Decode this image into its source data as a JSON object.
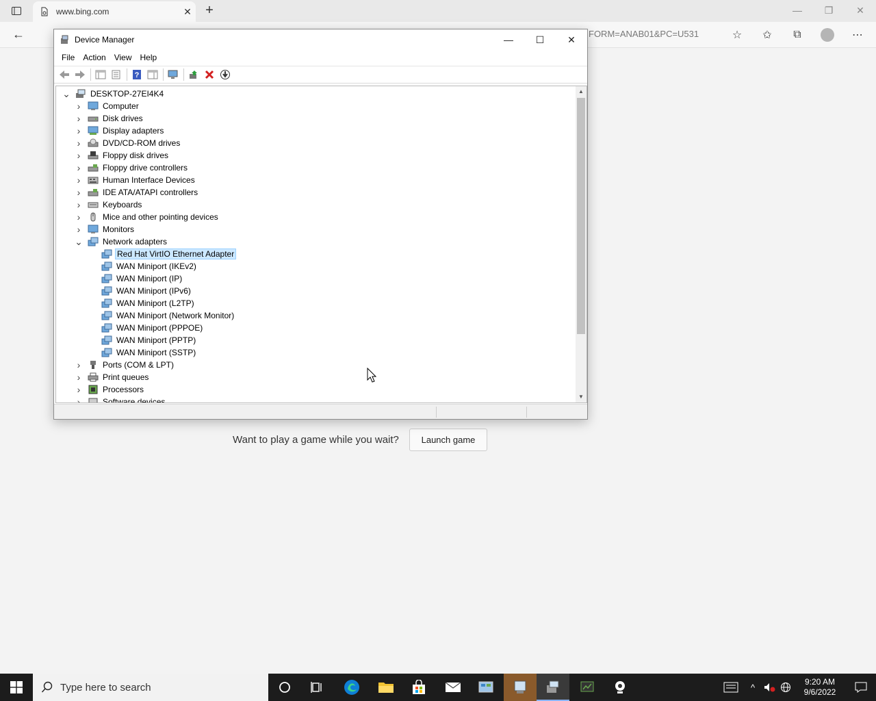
{
  "browser": {
    "tab_title": "www.bing.com",
    "url_fragment": "FORM=ANAB01&PC=U531",
    "wait_text": "Want to play a game while you wait?",
    "launch_label": "Launch game"
  },
  "device_manager": {
    "title": "Device Manager",
    "menu": [
      "File",
      "Action",
      "View",
      "Help"
    ],
    "tree": [
      {
        "label": "DESKTOP-27EI4K4",
        "level": 0,
        "state": "expanded",
        "icon": "computer-root-icon"
      },
      {
        "label": "Computer",
        "level": 1,
        "state": "collapsed",
        "icon": "monitor-icon"
      },
      {
        "label": "Disk drives",
        "level": 1,
        "state": "collapsed",
        "icon": "disk-drive-icon"
      },
      {
        "label": "Display adapters",
        "level": 1,
        "state": "collapsed",
        "icon": "display-adapter-icon"
      },
      {
        "label": "DVD/CD-ROM drives",
        "level": 1,
        "state": "collapsed",
        "icon": "dvd-icon"
      },
      {
        "label": "Floppy disk drives",
        "level": 1,
        "state": "collapsed",
        "icon": "floppy-icon"
      },
      {
        "label": "Floppy drive controllers",
        "level": 1,
        "state": "collapsed",
        "icon": "controller-icon"
      },
      {
        "label": "Human Interface Devices",
        "level": 1,
        "state": "collapsed",
        "icon": "hid-icon"
      },
      {
        "label": "IDE ATA/ATAPI controllers",
        "level": 1,
        "state": "collapsed",
        "icon": "controller-icon"
      },
      {
        "label": "Keyboards",
        "level": 1,
        "state": "collapsed",
        "icon": "keyboard-icon"
      },
      {
        "label": "Mice and other pointing devices",
        "level": 1,
        "state": "collapsed",
        "icon": "mouse-icon"
      },
      {
        "label": "Monitors",
        "level": 1,
        "state": "collapsed",
        "icon": "monitor-icon"
      },
      {
        "label": "Network adapters",
        "level": 1,
        "state": "expanded",
        "icon": "network-icon"
      },
      {
        "label": "Red Hat VirtIO Ethernet Adapter",
        "level": 2,
        "state": "leaf",
        "icon": "network-icon",
        "selected": true
      },
      {
        "label": "WAN Miniport (IKEv2)",
        "level": 2,
        "state": "leaf",
        "icon": "network-icon"
      },
      {
        "label": "WAN Miniport (IP)",
        "level": 2,
        "state": "leaf",
        "icon": "network-icon"
      },
      {
        "label": "WAN Miniport (IPv6)",
        "level": 2,
        "state": "leaf",
        "icon": "network-icon"
      },
      {
        "label": "WAN Miniport (L2TP)",
        "level": 2,
        "state": "leaf",
        "icon": "network-icon"
      },
      {
        "label": "WAN Miniport (Network Monitor)",
        "level": 2,
        "state": "leaf",
        "icon": "network-icon"
      },
      {
        "label": "WAN Miniport (PPPOE)",
        "level": 2,
        "state": "leaf",
        "icon": "network-icon"
      },
      {
        "label": "WAN Miniport (PPTP)",
        "level": 2,
        "state": "leaf",
        "icon": "network-icon"
      },
      {
        "label": "WAN Miniport (SSTP)",
        "level": 2,
        "state": "leaf",
        "icon": "network-icon"
      },
      {
        "label": "Ports (COM & LPT)",
        "level": 1,
        "state": "collapsed",
        "icon": "port-icon"
      },
      {
        "label": "Print queues",
        "level": 1,
        "state": "collapsed",
        "icon": "printer-icon"
      },
      {
        "label": "Processors",
        "level": 1,
        "state": "collapsed",
        "icon": "processor-icon"
      },
      {
        "label": "Software devices",
        "level": 1,
        "state": "collapsed",
        "icon": "software-icon"
      }
    ]
  },
  "taskbar": {
    "search_placeholder": "Type here to search",
    "time": "9:20 AM",
    "date": "9/6/2022"
  },
  "colors": {
    "selection": "#cce8ff",
    "taskbar": "#1c1c1c",
    "accent": "#0078d4"
  }
}
